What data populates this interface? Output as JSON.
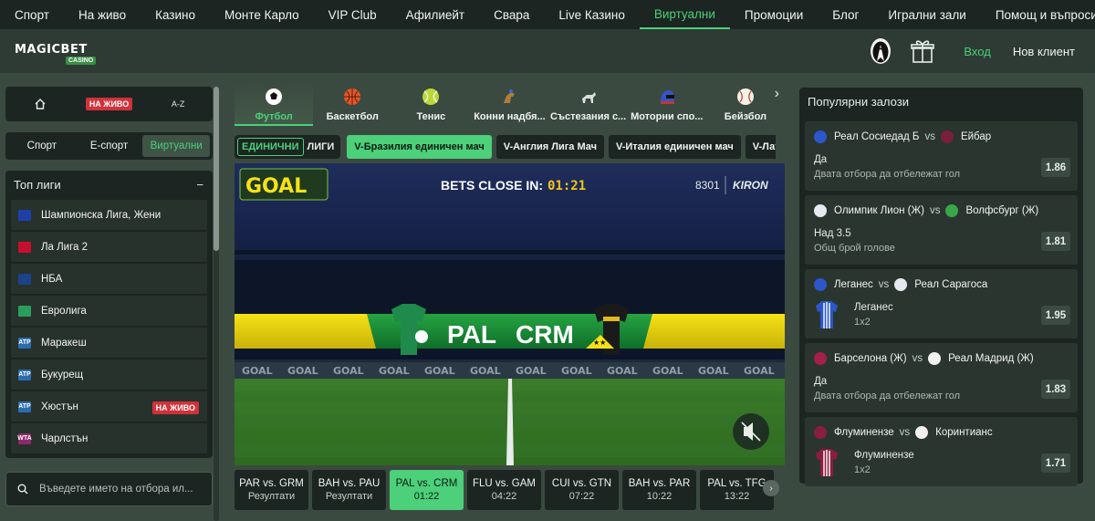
{
  "topnav": {
    "left": [
      "Спорт",
      "На живо",
      "Казино",
      "Монте Карло",
      "VIP Club",
      "Афилиейт",
      "Свара",
      "Live Казино",
      "Виртуални",
      "Промоции"
    ],
    "active": "Виртуални",
    "right": [
      "Блог",
      "Игрални зали",
      "Помощ и въпроси"
    ]
  },
  "header": {
    "logo_text": "MAGICBET",
    "logo_sub": "CASINO",
    "login": "Вход",
    "register": "Нов клиент",
    "icons": [
      "tuxedo-icon",
      "gift-icon"
    ]
  },
  "left": {
    "quick": {
      "home_icon": "home-icon",
      "live_label": "НА ЖИВО",
      "az_label": "A-Z"
    },
    "sport_tabs": [
      "Спорт",
      "Е-спорт",
      "Виртуални"
    ],
    "active_sport_tab": "Виртуални",
    "top_leagues_title": "Топ лиги",
    "collapse_symbol": "−",
    "leagues": [
      {
        "name": "Шампионска Лига, Жени",
        "icon": "eu-flag-icon",
        "color": "#1f3fa8",
        "live": false
      },
      {
        "name": "Ла Лига 2",
        "icon": "spain-flag-icon",
        "color": "#c8102e",
        "live": false
      },
      {
        "name": "НБА",
        "icon": "nba-icon",
        "color": "#1d428a",
        "live": false
      },
      {
        "name": "Евролига",
        "icon": "euroleague-icon",
        "color": "#2a9d5b",
        "live": false
      },
      {
        "name": "Маракеш",
        "icon": "atp-icon",
        "color": "#2b6cb0",
        "live": false
      },
      {
        "name": "Букурещ",
        "icon": "atp-icon",
        "color": "#2b6cb0",
        "live": false
      },
      {
        "name": "Хюстън",
        "icon": "atp-icon",
        "color": "#2b6cb0",
        "live": true
      },
      {
        "name": "Чарлстън",
        "icon": "wta-icon",
        "color": "#8e2a6b",
        "live": false
      }
    ],
    "live_badge": "НА ЖИВО",
    "search_placeholder": "Въведете името на отбора ил..."
  },
  "sports": [
    {
      "label": "Футбол",
      "icon": "soccer-ball-icon",
      "active": true
    },
    {
      "label": "Баскетбол",
      "icon": "basketball-icon",
      "active": false
    },
    {
      "label": "Тенис",
      "icon": "tennis-ball-icon",
      "active": false
    },
    {
      "label": "Конни надбя...",
      "icon": "horse-racing-icon",
      "active": false
    },
    {
      "label": "Състезания с...",
      "icon": "greyhound-icon",
      "active": false
    },
    {
      "label": "Моторни спо...",
      "icon": "motorsport-helmet-icon",
      "active": false
    },
    {
      "label": "Бейзбол",
      "icon": "baseball-icon",
      "active": false
    }
  ],
  "mode": {
    "single": "ЕДИНИЧНИ",
    "leagues": "ЛИГИ"
  },
  "league_tabs": [
    {
      "label": "V-Бразилия единичен мач",
      "active": true
    },
    {
      "label": "V-Англия Лига Мач",
      "active": false
    },
    {
      "label": "V-Италия единичен мач",
      "active": false
    },
    {
      "label": "V-Латинска",
      "active": false
    }
  ],
  "video": {
    "goal_logo": "GOAL",
    "bets_close": "BETS CLOSE IN:",
    "timer": "01:21",
    "match_id": "8301",
    "provider": "KIRON",
    "home": "PAL",
    "away": "CRM",
    "board_text": "GOAL",
    "mute_icon": "mute-speaker-icon"
  },
  "events": [
    {
      "teams": "PAR vs. GRM",
      "status": "Резултати",
      "active": false
    },
    {
      "teams": "BAH vs. PAU",
      "status": "Резултати",
      "active": false
    },
    {
      "teams": "PAL vs. CRM",
      "status": "01:22",
      "active": true
    },
    {
      "teams": "FLU vs. GAM",
      "status": "04:22",
      "active": false
    },
    {
      "teams": "CUI vs. GTN",
      "status": "07:22",
      "active": false
    },
    {
      "teams": "BAH vs. PAR",
      "status": "10:22",
      "active": false
    },
    {
      "teams": "PAL vs. TFG",
      "status": "13:22",
      "active": false
    }
  ],
  "popular": {
    "title": "Популярни залози",
    "vs": "vs",
    "picks": [
      {
        "home": "Реал Сосиедад Б",
        "away": "Ейбар",
        "selection": "Да",
        "market": "Двата отбора да отбележат гол",
        "odd": "1.86",
        "home_color": "#2b57c9",
        "away_color": "#7a1f3b",
        "jersey": false
      },
      {
        "home": "Олимпик Лион (Ж)",
        "away": "Волфсбург (Ж)",
        "selection": "Над 3.5",
        "market": "Общ брой голове",
        "odd": "1.81",
        "home_color": "#e6e9f0",
        "away_color": "#3aa64a",
        "jersey": false
      },
      {
        "home": "Леганес",
        "away": "Реал Сарагоса",
        "selection": "Леганес",
        "market": "1x2",
        "odd": "1.95",
        "home_color": "#2b57c9",
        "away_color": "#e6e9f0",
        "jersey": true,
        "jersey_color": "#2b57c9"
      },
      {
        "home": "Барселона (Ж)",
        "away": "Реал Мадрид (Ж)",
        "selection": "Да",
        "market": "Двата отбора да отбележат гол",
        "odd": "1.83",
        "home_color": "#a3204a",
        "away_color": "#f1f1f1",
        "jersey": false
      },
      {
        "home": "Флуминензе",
        "away": "Коринтианс",
        "selection": "Флуминензе",
        "market": "1x2",
        "odd": "1.71",
        "home_color": "#8b1e3f",
        "away_color": "#f1f1f1",
        "jersey": true,
        "jersey_color": "#8b1e3f"
      }
    ]
  }
}
